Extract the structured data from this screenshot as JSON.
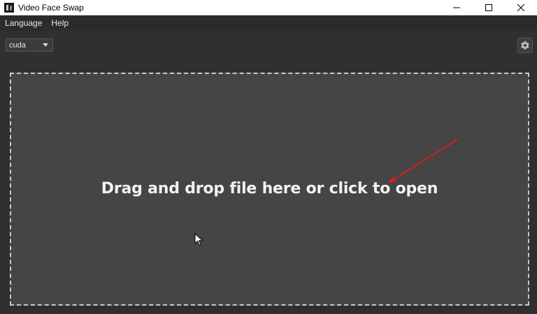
{
  "window": {
    "title": "Video Face Swap",
    "icons": {
      "app": "app-icon",
      "minimize": "minimize-icon",
      "maximize": "maximize-icon",
      "close": "close-icon"
    }
  },
  "menubar": {
    "items": [
      {
        "label": "Language"
      },
      {
        "label": "Help"
      }
    ]
  },
  "toolbar": {
    "device_select": {
      "value": "cuda",
      "icon": "chevron-down-icon"
    },
    "settings_icon": "gear-icon"
  },
  "dropzone": {
    "text": "Drag and drop file here or click to open"
  },
  "colors": {
    "window_bg": "#2f2f2f",
    "dropzone_bg": "#454545",
    "dropzone_border": "#c9c9c9",
    "annotation_arrow": "#d42020"
  }
}
